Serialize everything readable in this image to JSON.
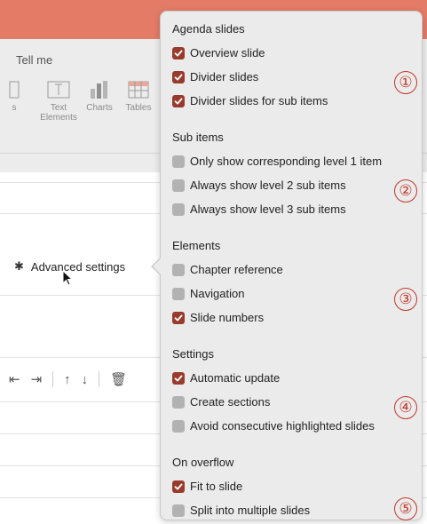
{
  "background": {
    "tell_me": "Tell me",
    "ribbon_buttons": [
      {
        "label": "s",
        "icon": "partial-icon"
      },
      {
        "label": "Text\nElements",
        "icon": "text-elements-icon"
      },
      {
        "label": "Charts",
        "icon": "charts-icon"
      },
      {
        "label": "Tables",
        "icon": "tables-icon"
      }
    ],
    "advanced_settings_label": "Advanced settings"
  },
  "popover": {
    "sections": [
      {
        "title": "Agenda slides",
        "marker": "①",
        "options": [
          {
            "label": "Overview slide",
            "checked": true
          },
          {
            "label": "Divider slides",
            "checked": true
          },
          {
            "label": "Divider slides for sub items",
            "checked": true
          }
        ]
      },
      {
        "title": "Sub items",
        "marker": "②",
        "options": [
          {
            "label": "Only show corresponding level 1 item",
            "checked": false
          },
          {
            "label": "Always show level 2 sub items",
            "checked": false
          },
          {
            "label": "Always show level 3 sub items",
            "checked": false
          }
        ]
      },
      {
        "title": "Elements",
        "marker": "③",
        "options": [
          {
            "label": "Chapter reference",
            "checked": false
          },
          {
            "label": "Navigation",
            "checked": false
          },
          {
            "label": "Slide numbers",
            "checked": true
          }
        ]
      },
      {
        "title": "Settings",
        "marker": "④",
        "options": [
          {
            "label": "Automatic update",
            "checked": true
          },
          {
            "label": "Create sections",
            "checked": false
          },
          {
            "label": "Avoid consecutive highlighted slides",
            "checked": false
          }
        ]
      },
      {
        "title": "On overflow",
        "marker": "⑤",
        "options": [
          {
            "label": "Fit to slide",
            "checked": true
          },
          {
            "label": "Split into multiple slides",
            "checked": false
          }
        ]
      }
    ]
  },
  "colors": {
    "checkbox_on": "#993b2c",
    "checkbox_off": "#b2b2b2",
    "marker": "#c0392b",
    "ribbon_top": "#e37b67"
  }
}
